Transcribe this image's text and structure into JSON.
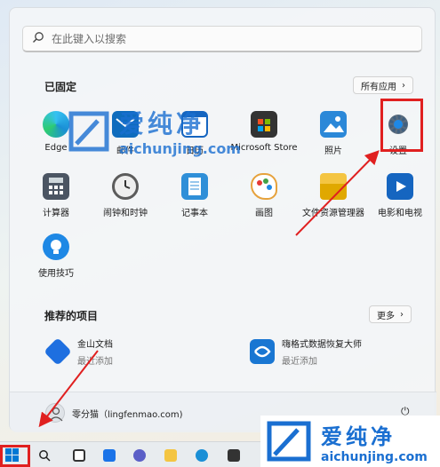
{
  "search": {
    "placeholder": "在此键入以搜索"
  },
  "pinned": {
    "title": "已固定",
    "all_apps_label": "所有应用",
    "apps": [
      {
        "label": "Edge",
        "icon": "edge-icon",
        "color": "#1a8fd6"
      },
      {
        "label": "邮件",
        "icon": "mail-icon",
        "color": "#0f6cbd"
      },
      {
        "label": "日历",
        "icon": "calendar-icon",
        "color": "#1565c0"
      },
      {
        "label": "Microsoft Store",
        "icon": "store-icon",
        "color": "#3b3b3b"
      },
      {
        "label": "照片",
        "icon": "photos-icon",
        "color": "#2b88d8"
      },
      {
        "label": "设置",
        "icon": "gear-icon",
        "color": "#3f5f7f"
      },
      {
        "label": "计算器",
        "icon": "calculator-icon",
        "color": "#4b5563"
      },
      {
        "label": "闹钟和时钟",
        "icon": "clock-icon",
        "color": "#5b5b5b"
      },
      {
        "label": "记事本",
        "icon": "notepad-icon",
        "color": "#2f8fd8"
      },
      {
        "label": "画图",
        "icon": "paint-icon",
        "color": "#e6a23c"
      },
      {
        "label": "文件资源管理器",
        "icon": "folder-icon",
        "color": "#f4c542"
      },
      {
        "label": "电影和电视",
        "icon": "movies-icon",
        "color": "#1565c0"
      },
      {
        "label": "使用技巧",
        "icon": "tips-icon",
        "color": "#1e88e5"
      }
    ]
  },
  "recommended": {
    "title": "推荐的项目",
    "more_label": "更多",
    "items": [
      {
        "name": "金山文档",
        "sub": "最近添加",
        "icon": "kingsoft-docs-icon",
        "color": "#1e6fe0"
      },
      {
        "name": "嗨格式数据恢复大师",
        "sub": "最近添加",
        "icon": "data-recovery-icon",
        "color": "#1976d2"
      }
    ]
  },
  "user": {
    "name": "零分猫（lingfenmao.com)"
  },
  "watermark": {
    "brand": "爱纯净",
    "url": "aichunjing.com"
  },
  "colors": {
    "highlight": "#e02020",
    "accent": "#0067c0"
  }
}
